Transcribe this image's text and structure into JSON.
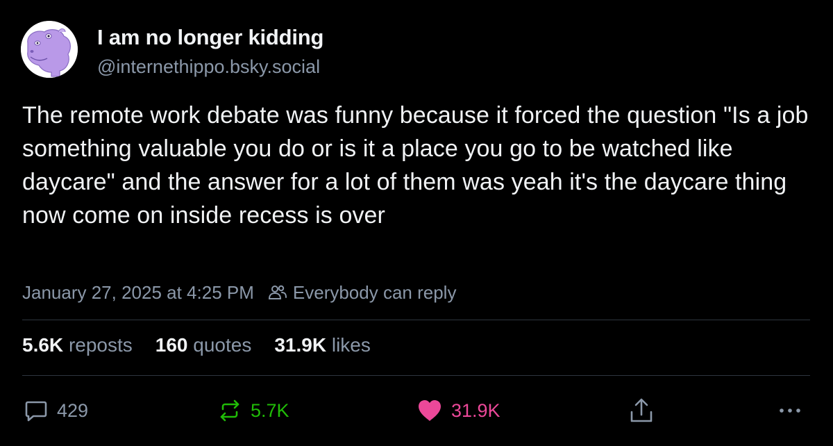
{
  "author": {
    "display_name": "I am no longer kidding",
    "handle": "@internethippo.bsky.social",
    "avatar_icon": "hippo-avatar-icon"
  },
  "post": {
    "text": "The remote work debate was funny because it forced the question \"Is a job something valuable you do or is it a place you go to be watched like daycare\" and the answer for a lot of them was yeah it's the daycare thing now come on inside recess is over",
    "timestamp": "January 27, 2025 at 4:25 PM",
    "reply_setting": "Everybody can reply"
  },
  "stats": {
    "reposts_count": "5.6K",
    "reposts_label": "reposts",
    "quotes_count": "160",
    "quotes_label": "quotes",
    "likes_count": "31.9K",
    "likes_label": "likes"
  },
  "actions": {
    "reply_count": "429",
    "repost_count": "5.7K",
    "like_count": "31.9K"
  },
  "colors": {
    "background": "#000000",
    "text": "#f1f3f5",
    "muted": "#8b98a9",
    "repost_active": "#20bc07",
    "like_active": "#ec4899",
    "avatar": "#b999e8"
  }
}
